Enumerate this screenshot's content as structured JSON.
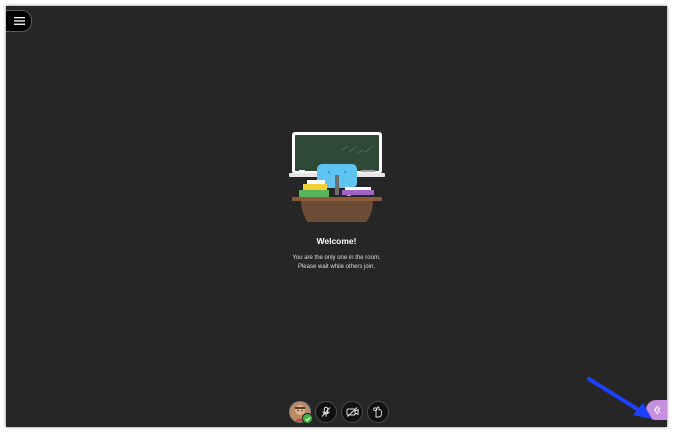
{
  "welcome": {
    "title": "Welcome!",
    "line1": "You are the only one in the room.",
    "line2": "Please wait while others join."
  },
  "icons": {
    "menu": "hamburger-menu-icon",
    "mic": "microphone-off-icon",
    "camera": "camera-off-icon",
    "hand": "raise-hand-icon",
    "status": "checkmark-icon",
    "collab": "chevron-left-icon"
  },
  "colors": {
    "background": "#262626",
    "collab_panel_toggle": "#c88fe0",
    "status_available": "#3fb23f",
    "annotation_arrow": "#1e40ff"
  }
}
